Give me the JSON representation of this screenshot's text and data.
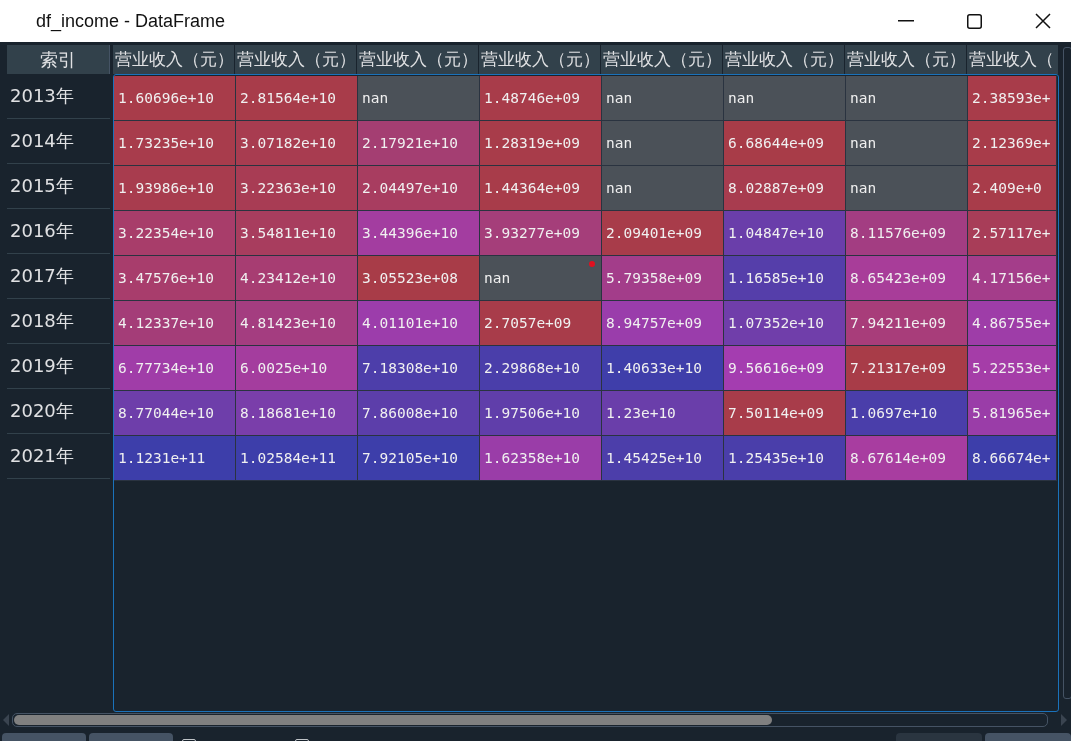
{
  "window": {
    "title": "df_income - DataFrame"
  },
  "index_header": "索引",
  "columns": [
    "营业收入（元）",
    "营业收入（元）",
    "营业收入（元）",
    "营业收入（元）",
    "营业收入（元）",
    "营业收入（元）",
    "营业收入（元）",
    "营业收入（"
  ],
  "rows": [
    {
      "index": "2013年",
      "cells": [
        {
          "text": "1.60696e+10",
          "color": "#a83c4a"
        },
        {
          "text": "2.81564e+10",
          "color": "#a83c4a"
        },
        {
          "text": "nan",
          "color": "#4b5158"
        },
        {
          "text": "1.48746e+09",
          "color": "#a83c4a"
        },
        {
          "text": "nan",
          "color": "#4b5158"
        },
        {
          "text": "nan",
          "color": "#4b5158"
        },
        {
          "text": "nan",
          "color": "#4b5158"
        },
        {
          "text": "2.38593e+",
          "color": "#a83c4a"
        }
      ]
    },
    {
      "index": "2014年",
      "cells": [
        {
          "text": "1.73235e+10",
          "color": "#a83c4c"
        },
        {
          "text": "3.07182e+10",
          "color": "#a83c50"
        },
        {
          "text": "2.17921e+10",
          "color": "#a43e72"
        },
        {
          "text": "1.28319e+09",
          "color": "#a83c4a"
        },
        {
          "text": "nan",
          "color": "#4b5158"
        },
        {
          "text": "6.68644e+09",
          "color": "#a83c48"
        },
        {
          "text": "nan",
          "color": "#4b5158"
        },
        {
          "text": "2.12369e+",
          "color": "#a83c4a"
        }
      ]
    },
    {
      "index": "2015年",
      "cells": [
        {
          "text": "1.93986e+10",
          "color": "#a83c4e"
        },
        {
          "text": "3.22363e+10",
          "color": "#a83c54"
        },
        {
          "text": "2.04497e+10",
          "color": "#a83d60"
        },
        {
          "text": "1.44364e+09",
          "color": "#a83c4a"
        },
        {
          "text": "nan",
          "color": "#4b5158"
        },
        {
          "text": "8.02887e+09",
          "color": "#a83c4f"
        },
        {
          "text": "nan",
          "color": "#4b5158"
        },
        {
          "text": "2.409e+0",
          "color": "#a83c4a"
        }
      ]
    },
    {
      "index": "2016年",
      "cells": [
        {
          "text": "3.22354e+10",
          "color": "#a83d6a"
        },
        {
          "text": "3.54811e+10",
          "color": "#a83d5e"
        },
        {
          "text": "3.44396e+10",
          "color": "#a33da0"
        },
        {
          "text": "3.93277e+09",
          "color": "#a53e7a"
        },
        {
          "text": "2.09401e+09",
          "color": "#a83c4a"
        },
        {
          "text": "1.04847e+10",
          "color": "#6a3eaa"
        },
        {
          "text": "8.11576e+09",
          "color": "#a33d82"
        },
        {
          "text": "2.57117e+",
          "color": "#a83d58"
        }
      ]
    },
    {
      "index": "2017年",
      "cells": [
        {
          "text": "3.47576e+10",
          "color": "#a83d6c"
        },
        {
          "text": "4.23412e+10",
          "color": "#a73d72"
        },
        {
          "text": "3.05523e+08",
          "color": "#a83c48"
        },
        {
          "text": "nan",
          "color": "#4b5158",
          "flagged": true
        },
        {
          "text": "5.79358e+09",
          "color": "#a33d8a"
        },
        {
          "text": "1.16585e+10",
          "color": "#553eaa"
        },
        {
          "text": "8.65423e+09",
          "color": "#a83d99"
        },
        {
          "text": "4.17156e+",
          "color": "#a43d8a"
        }
      ]
    },
    {
      "index": "2018年",
      "cells": [
        {
          "text": "4.12337e+10",
          "color": "#a43d78"
        },
        {
          "text": "4.81423e+10",
          "color": "#a43d80"
        },
        {
          "text": "4.01101e+10",
          "color": "#9c3dab"
        },
        {
          "text": "2.7057e+09",
          "color": "#a83c4a"
        },
        {
          "text": "8.94757e+09",
          "color": "#9a3dab"
        },
        {
          "text": "1.07352e+10",
          "color": "#703eaa"
        },
        {
          "text": "7.94211e+09",
          "color": "#a83d7a"
        },
        {
          "text": "4.86755e+",
          "color": "#9e3da8"
        }
      ]
    },
    {
      "index": "2019年",
      "cells": [
        {
          "text": "6.77734e+10",
          "color": "#a03da8"
        },
        {
          "text": "6.0025e+10",
          "color": "#a43d9e"
        },
        {
          "text": "7.18308e+10",
          "color": "#4d3eaa"
        },
        {
          "text": "2.29868e+10",
          "color": "#4a3eaa"
        },
        {
          "text": "1.40633e+10",
          "color": "#3f3eaa"
        },
        {
          "text": "9.56616e+09",
          "color": "#a43db0"
        },
        {
          "text": "7.21317e+09",
          "color": "#a83c48"
        },
        {
          "text": "5.22553e+",
          "color": "#a53da8"
        }
      ]
    },
    {
      "index": "2020年",
      "cells": [
        {
          "text": "8.77044e+10",
          "color": "#6e3eaa"
        },
        {
          "text": "8.18681e+10",
          "color": "#7a3eaa"
        },
        {
          "text": "7.86008e+10",
          "color": "#5c3eaa"
        },
        {
          "text": "1.97506e+10",
          "color": "#603eaa"
        },
        {
          "text": "1.23e+10",
          "color": "#6a3eaa"
        },
        {
          "text": "7.50114e+09",
          "color": "#a83c4a"
        },
        {
          "text": "1.0697e+10",
          "color": "#4a3eaa"
        },
        {
          "text": "5.81965e+",
          "color": "#9a3da8"
        }
      ]
    },
    {
      "index": "2021年",
      "cells": [
        {
          "text": "1.1231e+11",
          "color": "#3d3eaa"
        },
        {
          "text": "1.02584e+11",
          "color": "#3d3eaa"
        },
        {
          "text": "7.92105e+10",
          "color": "#3d3eaa"
        },
        {
          "text": "1.62358e+10",
          "color": "#9a3da8"
        },
        {
          "text": "1.45425e+10",
          "color": "#4c3eaa"
        },
        {
          "text": "1.25435e+10",
          "color": "#4a3eaa"
        },
        {
          "text": "8.67614e+09",
          "color": "#a83da0"
        },
        {
          "text": "8.66674e+",
          "color": "#3d3eaa"
        }
      ]
    }
  ],
  "bottom_controls": [
    {
      "kind": "button",
      "disabled": false
    },
    {
      "kind": "button",
      "disabled": false
    },
    {
      "kind": "checkbox",
      "checked": false
    },
    {
      "kind": "checkbox",
      "checked": false
    },
    {
      "kind": "spacer"
    },
    {
      "kind": "button",
      "disabled": true
    },
    {
      "kind": "button",
      "disabled": false
    }
  ]
}
